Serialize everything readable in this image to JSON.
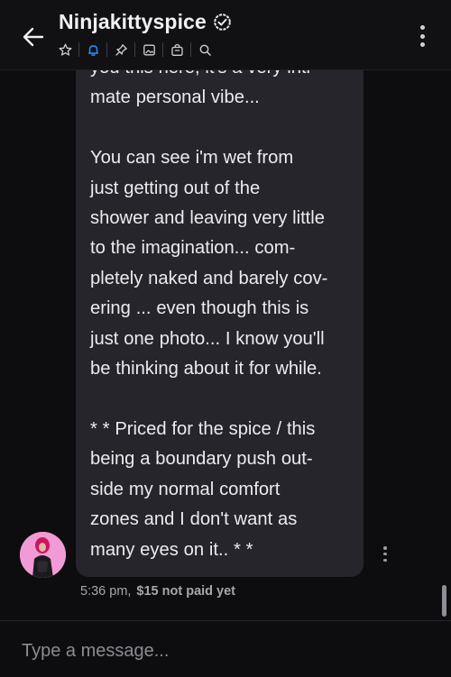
{
  "header": {
    "title": "Ninjakittyspice",
    "icons": [
      "star-icon",
      "bell-icon",
      "pin-icon",
      "image-icon",
      "bag-icon",
      "search-icon"
    ]
  },
  "message": {
    "text": "you this here, it's a very inti-\nmate personal vibe...\n\nYou can see i'm wet from\njust getting out of the\nshower and leaving very little\nto the imagination... com-\npletely naked and barely cov-\nering ... even though this is\njust one photo... I know you'll\nbe thinking about it for while.\n\n* * Priced for the spice / this\nbeing a boundary push out-\nside my normal comfort\nzones and I don't want as\nmany eyes on it.. * *",
    "time": "5:36 pm,",
    "price_status": "$15 not paid yet"
  },
  "composer": {
    "placeholder": "Type a message..."
  },
  "colors": {
    "accent": "#2f8fff",
    "avatar_bg": "#f29ad6",
    "bubble": "#25252b"
  }
}
